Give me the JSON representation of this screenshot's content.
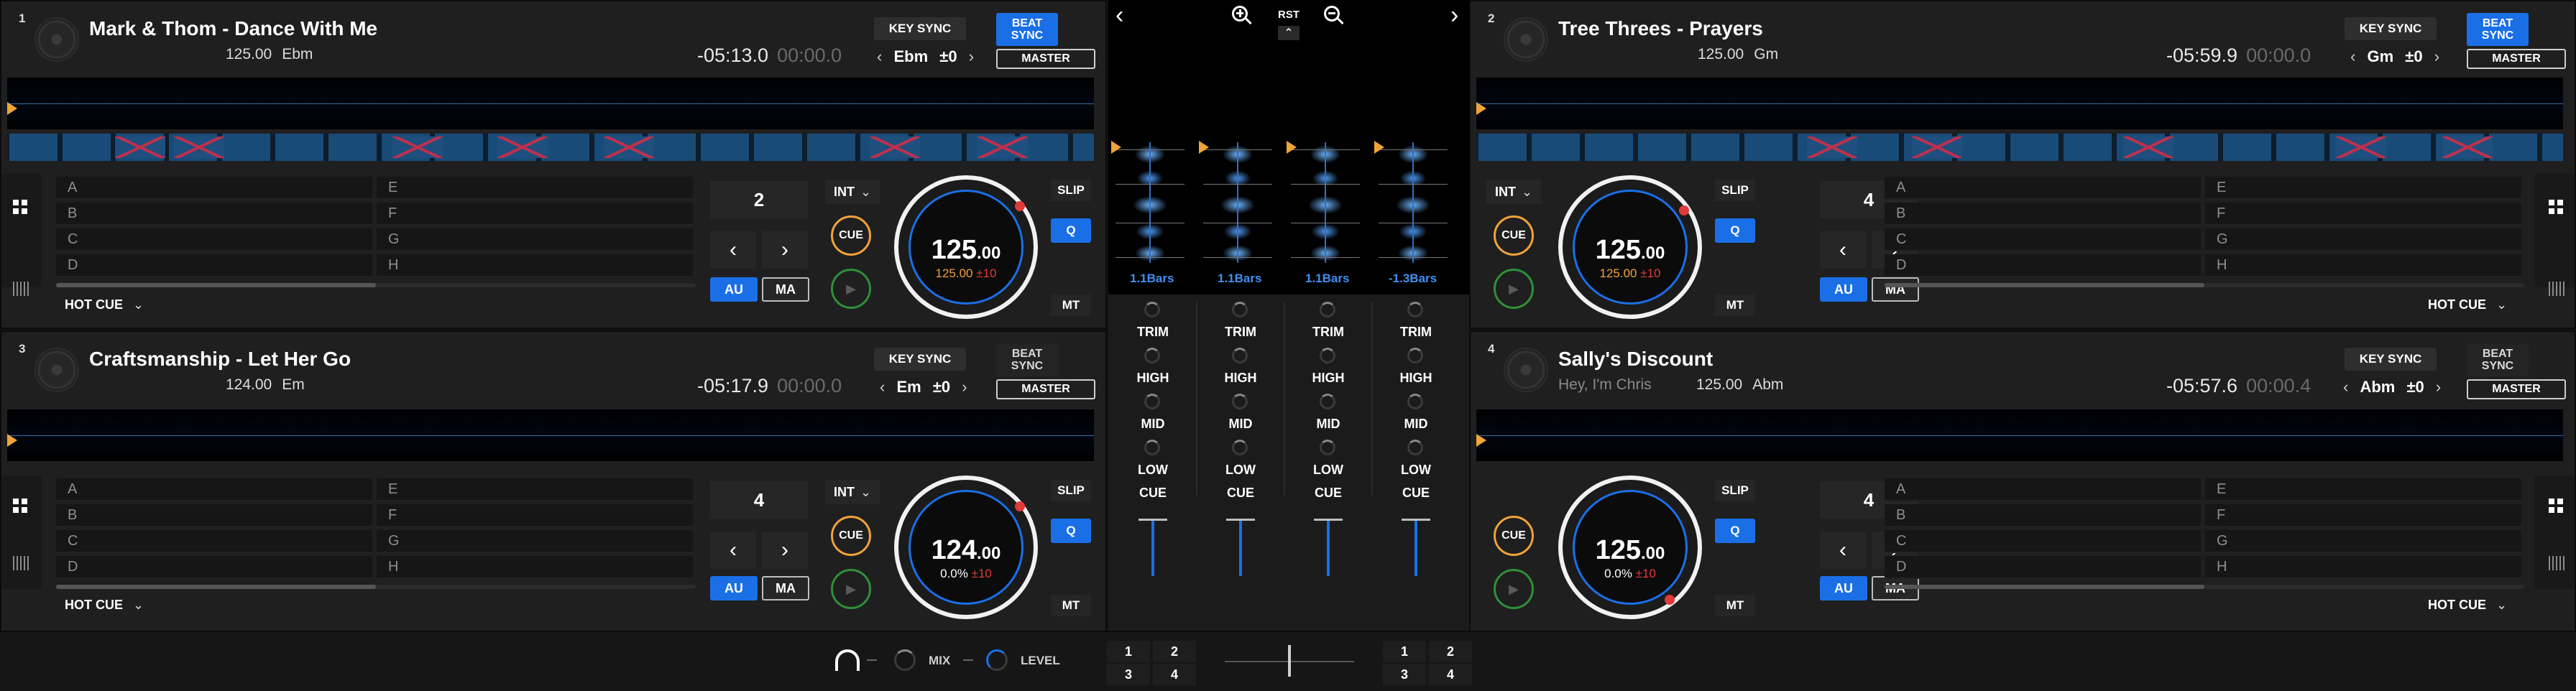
{
  "colors": {
    "accent_blue": "#1a6fe6",
    "cue_orange": "#f1a23b",
    "play_green": "#2f8f3a",
    "marker_red": "#e03a3a",
    "background": "#1f1f1f"
  },
  "decks": [
    {
      "number": "1",
      "title": "Mark & Thom - Dance With Me",
      "artist": "",
      "bpm": "125.00",
      "key": "Ebm",
      "remaining": "-05:13.0",
      "elapsed": "00:00.0",
      "key_sync": "KEY SYNC",
      "beat_sync": "BEAT SYNC",
      "beat_sync_active": true,
      "key_value": "Ebm",
      "key_shift": "±0",
      "master": "MASTER",
      "hotcues": [
        "A",
        "B",
        "C",
        "D",
        "E",
        "F",
        "G",
        "H"
      ],
      "hotcue_mode": "HOT CUE",
      "loop_beats": "2",
      "int": "INT",
      "cue": "CUE",
      "au": "AU",
      "ma": "MA",
      "jog_bpm_main": "125",
      "jog_bpm_dec": ".00",
      "jog_pitch": "125.00",
      "jog_range": "±10",
      "slip": "SLIP",
      "q": "Q",
      "mt": "MT"
    },
    {
      "number": "2",
      "title": "Tree Threes - Prayers",
      "artist": "",
      "bpm": "125.00",
      "key": "Gm",
      "remaining": "-05:59.9",
      "elapsed": "00:00.0",
      "key_sync": "KEY SYNC",
      "beat_sync": "BEAT SYNC",
      "beat_sync_active": true,
      "key_value": "Gm",
      "key_shift": "±0",
      "master": "MASTER",
      "hotcues": [
        "A",
        "B",
        "C",
        "D",
        "E",
        "F",
        "G",
        "H"
      ],
      "hotcue_mode": "HOT CUE",
      "loop_beats": "4",
      "int": "INT",
      "cue": "CUE",
      "au": "AU",
      "ma": "MA",
      "jog_bpm_main": "125",
      "jog_bpm_dec": ".00",
      "jog_pitch": "125.00",
      "jog_range": "±10",
      "slip": "SLIP",
      "q": "Q",
      "mt": "MT"
    },
    {
      "number": "3",
      "title": "Craftsmanship - Let Her Go",
      "artist": "",
      "bpm": "124.00",
      "key": "Em",
      "remaining": "-05:17.9",
      "elapsed": "00:00.0",
      "key_sync": "KEY SYNC",
      "beat_sync": "BEAT SYNC",
      "beat_sync_active": false,
      "key_value": "Em",
      "key_shift": "±0",
      "master": "MASTER",
      "hotcues": [
        "A",
        "B",
        "C",
        "D",
        "E",
        "F",
        "G",
        "H"
      ],
      "hotcue_mode": "HOT CUE",
      "loop_beats": "4",
      "int": "INT",
      "cue": "CUE",
      "au": "AU",
      "ma": "MA",
      "jog_bpm_main": "124",
      "jog_bpm_dec": ".00",
      "jog_pitch": "0.0%",
      "jog_range": "±10",
      "slip": "SLIP",
      "q": "Q",
      "mt": "MT"
    },
    {
      "number": "4",
      "title": "Sally's Discount",
      "artist": "Hey, I'm Chris",
      "bpm": "125.00",
      "key": "Abm",
      "remaining": "-05:57.6",
      "elapsed": "00:00.4",
      "key_sync": "KEY SYNC",
      "beat_sync": "BEAT SYNC",
      "beat_sync_active": false,
      "key_value": "Abm",
      "key_shift": "±0",
      "master": "MASTER",
      "hotcues": [
        "A",
        "B",
        "C",
        "D",
        "E",
        "F",
        "G",
        "H"
      ],
      "hotcue_mode": "HOT CUE",
      "loop_beats": "4",
      "int": "INT",
      "cue": "CUE",
      "au": "AU",
      "ma": "MA",
      "jog_bpm_main": "125",
      "jog_bpm_dec": ".00",
      "jog_pitch": "0.0%",
      "jog_range": "±10",
      "slip": "SLIP",
      "q": "Q",
      "mt": "MT"
    }
  ],
  "mixer": {
    "rst": "RST",
    "left_arrow": "‹",
    "right_arrow": "›",
    "bars": [
      "1.1Bars",
      "1.1Bars",
      "1.1Bars",
      "-1.3Bars"
    ],
    "eq_labels": [
      "TRIM",
      "HIGH",
      "MID",
      "LOW",
      "CUE"
    ]
  },
  "bottom": {
    "mix_label": "MIX",
    "level_label": "LEVEL",
    "left_channels": [
      "1",
      "2",
      "3",
      "4"
    ],
    "right_channels": [
      "1",
      "2",
      "3",
      "4"
    ]
  }
}
